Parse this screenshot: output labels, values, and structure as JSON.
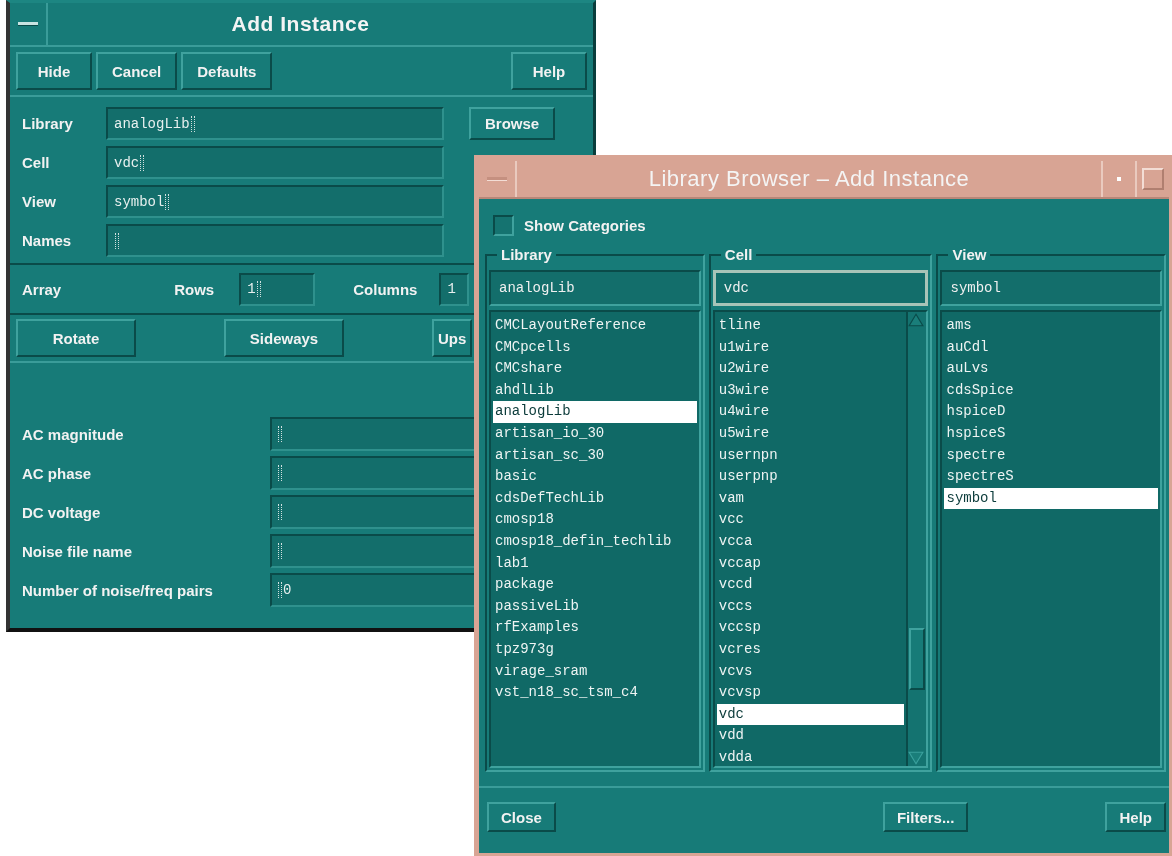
{
  "add_instance": {
    "title": "Add Instance",
    "buttons": [
      "Hide",
      "Cancel",
      "Defaults"
    ],
    "help_button": "Help",
    "fields": [
      {
        "label": "Library",
        "value": "analogLib"
      },
      {
        "label": "Cell",
        "value": "vdc"
      },
      {
        "label": "View",
        "value": "symbol"
      },
      {
        "label": "Names"
      }
    ],
    "browse_button": "Browse",
    "array": {
      "label": "Array",
      "rows_label": "Rows",
      "rows_value": "1",
      "columns_label": "Columns",
      "columns_value": "1"
    },
    "transform_buttons": [
      "Rotate",
      "Sideways",
      "Ups"
    ],
    "parameters": [
      {
        "label": "AC magnitude"
      },
      {
        "label": "AC phase"
      },
      {
        "label": "DC voltage"
      },
      {
        "label": "Noise file name"
      },
      {
        "label": "Number of noise/freq pairs",
        "value": "0"
      }
    ]
  },
  "library_browser": {
    "title": "Library Browser – Add Instance",
    "show_categories": {
      "label": "Show Categories",
      "checked": false
    },
    "columns": [
      {
        "title": "Library",
        "filter": "analogLib",
        "scroll_bar": false,
        "items": [
          {
            "label": "CMCLayoutReference",
            "selected": false
          },
          {
            "label": "CMCpcells",
            "selected": false
          },
          {
            "label": "CMCshare",
            "selected": false
          },
          {
            "label": "ahdlLib",
            "selected": false
          },
          {
            "label": "analogLib",
            "selected": true
          },
          {
            "label": "artisan_io_30",
            "selected": false
          },
          {
            "label": "artisan_sc_30",
            "selected": false
          },
          {
            "label": "basic",
            "selected": false
          },
          {
            "label": "cdsDefTechLib",
            "selected": false
          },
          {
            "label": "cmosp18",
            "selected": false
          },
          {
            "label": "cmosp18_defin_techlib",
            "selected": false
          },
          {
            "label": "lab1",
            "selected": false
          },
          {
            "label": "package",
            "selected": false
          },
          {
            "label": "passiveLib",
            "selected": false
          },
          {
            "label": "rfExamples",
            "selected": false
          },
          {
            "label": "tpz973g",
            "selected": false
          },
          {
            "label": "virage_sram",
            "selected": false
          },
          {
            "label": "vst_n18_sc_tsm_c4",
            "selected": false
          }
        ]
      },
      {
        "title": "Cell",
        "filter": "vdc",
        "scroll_bar": true,
        "items": [
          {
            "label": "tline",
            "selected": false
          },
          {
            "label": "u1wire",
            "selected": false
          },
          {
            "label": "u2wire",
            "selected": false
          },
          {
            "label": "u3wire",
            "selected": false
          },
          {
            "label": "u4wire",
            "selected": false
          },
          {
            "label": "u5wire",
            "selected": false
          },
          {
            "label": "usernpn",
            "selected": false
          },
          {
            "label": "userpnp",
            "selected": false
          },
          {
            "label": "vam",
            "selected": false
          },
          {
            "label": "vcc",
            "selected": false
          },
          {
            "label": "vcca",
            "selected": false
          },
          {
            "label": "vccap",
            "selected": false
          },
          {
            "label": "vccd",
            "selected": false
          },
          {
            "label": "vccs",
            "selected": false
          },
          {
            "label": "vccsp",
            "selected": false
          },
          {
            "label": "vcres",
            "selected": false
          },
          {
            "label": "vcvs",
            "selected": false
          },
          {
            "label": "vcvsp",
            "selected": false
          },
          {
            "label": "vdc",
            "selected": true
          },
          {
            "label": "vdd",
            "selected": false
          },
          {
            "label": "vdda",
            "selected": false
          }
        ]
      },
      {
        "title": "View",
        "filter": "symbol",
        "scroll_bar": false,
        "items": [
          {
            "label": "ams",
            "selected": false
          },
          {
            "label": "auCdl",
            "selected": false
          },
          {
            "label": "auLvs",
            "selected": false
          },
          {
            "label": "cdsSpice",
            "selected": false
          },
          {
            "label": "hspiceD",
            "selected": false
          },
          {
            "label": "hspiceS",
            "selected": false
          },
          {
            "label": "spectre",
            "selected": false
          },
          {
            "label": "spectreS",
            "selected": false
          },
          {
            "label": "symbol",
            "selected": true
          }
        ]
      }
    ],
    "buttons": [
      "Close",
      "Filters...",
      "Help"
    ]
  }
}
